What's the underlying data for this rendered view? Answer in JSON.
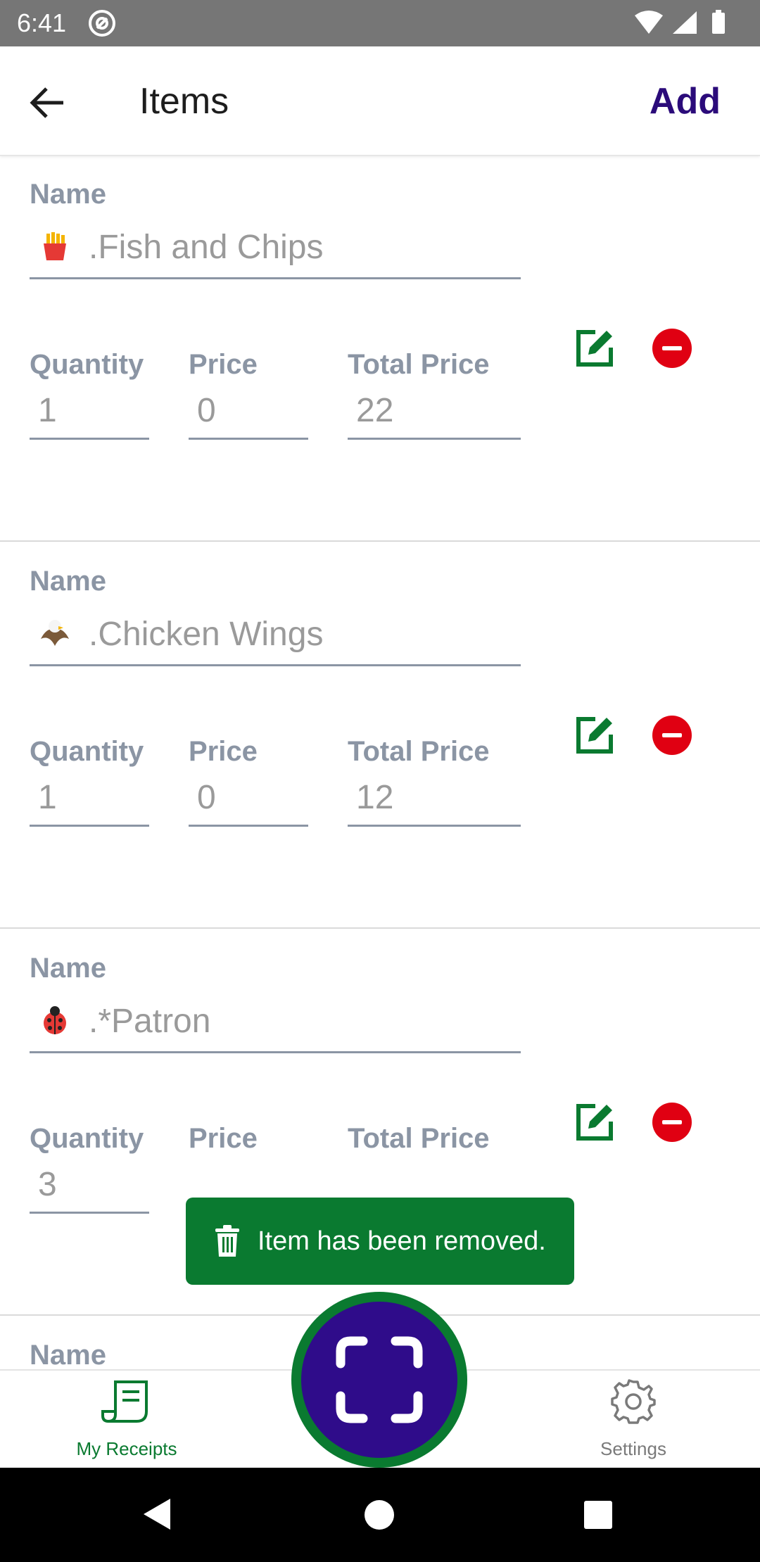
{
  "status_bar": {
    "time": "6:41"
  },
  "appbar": {
    "title": "Items",
    "add_label": "Add"
  },
  "labels": {
    "name": "Name",
    "quantity": "Quantity",
    "price": "Price",
    "total_price": "Total Price"
  },
  "items": [
    {
      "emoji": "fries-emoji",
      "name": ".Fish and Chips",
      "quantity": "1",
      "price": "0",
      "total_price": "22"
    },
    {
      "emoji": "eagle-emoji",
      "name": ".Chicken Wings",
      "quantity": "1",
      "price": "0",
      "total_price": "12"
    },
    {
      "emoji": "ladybug-emoji",
      "name": ".*Patron",
      "quantity": "3",
      "price": "",
      "total_price": ""
    }
  ],
  "toast": {
    "message": "Item has been removed."
  },
  "bottom_nav": {
    "receipts_label": "My Receipts",
    "settings_label": "Settings"
  },
  "colors": {
    "accent_green": "#0a7a30",
    "brand_purple": "#2f0c8a",
    "remove_red": "#e00012",
    "label_gray": "#8b95a4"
  }
}
